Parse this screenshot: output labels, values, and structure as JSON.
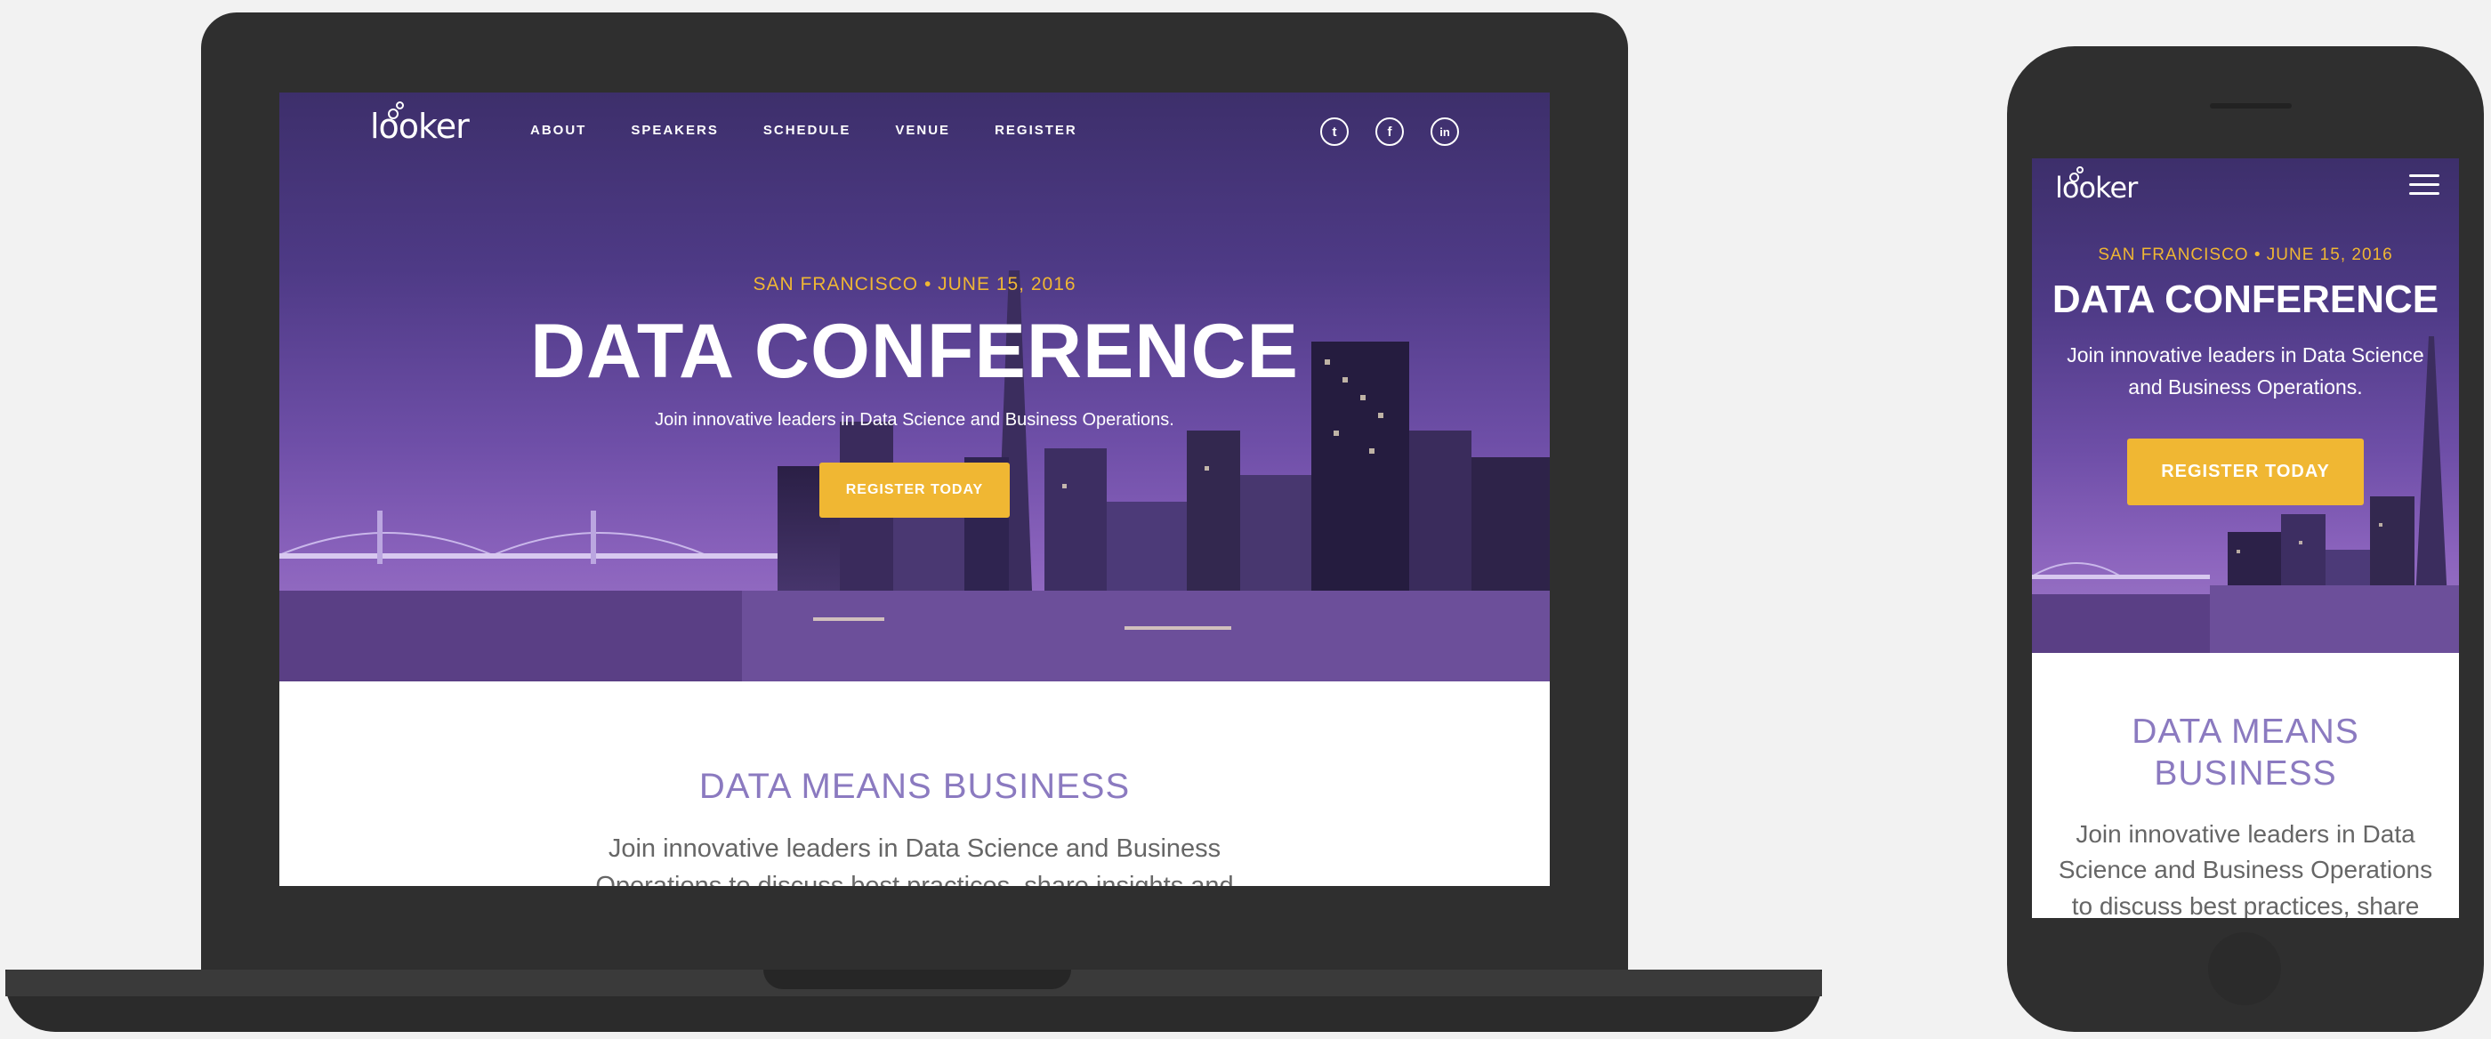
{
  "brand": {
    "logo_text": "looker"
  },
  "nav": {
    "items": [
      "ABOUT",
      "SPEAKERS",
      "SCHEDULE",
      "VENUE",
      "REGISTER"
    ]
  },
  "social": {
    "twitter": "twitter-icon",
    "facebook": "facebook-icon",
    "linkedin": "linkedin-icon",
    "twitter_glyph": "t",
    "facebook_glyph": "f",
    "linkedin_glyph": "in"
  },
  "hero": {
    "eyebrow": "SAN FRANCISCO • JUNE 15, 2016",
    "title": "DATA CONFERENCE",
    "subtitle": "Join innovative leaders in Data Science and Business Operations.",
    "cta": "REGISTER TODAY"
  },
  "section": {
    "title": "DATA MEANS BUSINESS",
    "text": "Join innovative leaders in Data Science and Business Operations to discuss best practices, share insights and brainstorm how to"
  },
  "colors": {
    "accent": "#f0b733",
    "section_title": "#8b7ac0",
    "hero_purple": "#4e3a86"
  }
}
